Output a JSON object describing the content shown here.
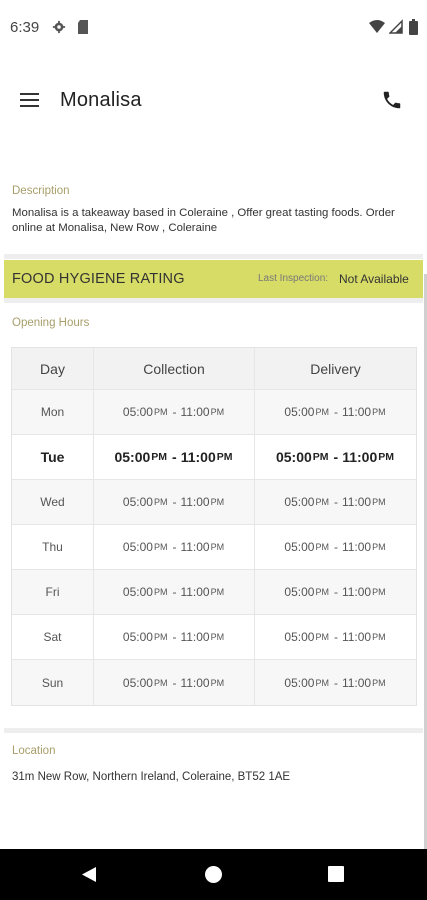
{
  "status_bar": {
    "time": "6:39",
    "icons": [
      "gear-icon",
      "sd-card-icon",
      "wifi-icon",
      "signal-icon",
      "battery-icon"
    ]
  },
  "app_bar": {
    "title": "Monalisa",
    "menu_icon": "hamburger-menu-icon",
    "action_icon": "phone-icon"
  },
  "description": {
    "label": "Description",
    "text": "Monalisa   is a takeaway based in Coleraine , Offer great tasting foods. Order online at Monalisa, New Row , Coleraine"
  },
  "hygiene": {
    "title": "FOOD HYGIENE RATING",
    "inspection_label": "Last Inspection:",
    "inspection_value": "Not Available",
    "bar_color": "#d7dc67"
  },
  "opening_hours": {
    "label": "Opening Hours",
    "headers": {
      "day": "Day",
      "collection": "Collection",
      "delivery": "Delivery"
    },
    "rows": [
      {
        "day": "Mon",
        "c_open": "05:00",
        "c_open_ap": "PM",
        "c_close": "11:00",
        "c_close_ap": "PM",
        "d_open": "05:00",
        "d_open_ap": "PM",
        "d_close": "11:00",
        "d_close_ap": "PM"
      },
      {
        "day": "Tue",
        "c_open": "05:00",
        "c_open_ap": "PM",
        "c_close": "11:00",
        "c_close_ap": "PM",
        "d_open": "05:00",
        "d_open_ap": "PM",
        "d_close": "11:00",
        "d_close_ap": "PM"
      },
      {
        "day": "Wed",
        "c_open": "05:00",
        "c_open_ap": "PM",
        "c_close": "11:00",
        "c_close_ap": "PM",
        "d_open": "05:00",
        "d_open_ap": "PM",
        "d_close": "11:00",
        "d_close_ap": "PM"
      },
      {
        "day": "Thu",
        "c_open": "05:00",
        "c_open_ap": "PM",
        "c_close": "11:00",
        "c_close_ap": "PM",
        "d_open": "05:00",
        "d_open_ap": "PM",
        "d_close": "11:00",
        "d_close_ap": "PM"
      },
      {
        "day": "Fri",
        "c_open": "05:00",
        "c_open_ap": "PM",
        "c_close": "11:00",
        "c_close_ap": "PM",
        "d_open": "05:00",
        "d_open_ap": "PM",
        "d_close": "11:00",
        "d_close_ap": "PM"
      },
      {
        "day": "Sat",
        "c_open": "05:00",
        "c_open_ap": "PM",
        "c_close": "11:00",
        "c_close_ap": "PM",
        "d_open": "05:00",
        "d_open_ap": "PM",
        "d_close": "11:00",
        "d_close_ap": "PM"
      },
      {
        "day": "Sun",
        "c_open": "05:00",
        "c_open_ap": "PM",
        "c_close": "11:00",
        "c_close_ap": "PM",
        "d_open": "05:00",
        "d_open_ap": "PM",
        "d_close": "11:00",
        "d_close_ap": "PM"
      }
    ],
    "separator": "-"
  },
  "location": {
    "label": "Location",
    "address": "31m New Row, Northern Ireland, Coleraine, BT52 1AE"
  },
  "nav_bar": {
    "buttons": [
      "back-icon",
      "home-icon",
      "recents-icon"
    ]
  }
}
